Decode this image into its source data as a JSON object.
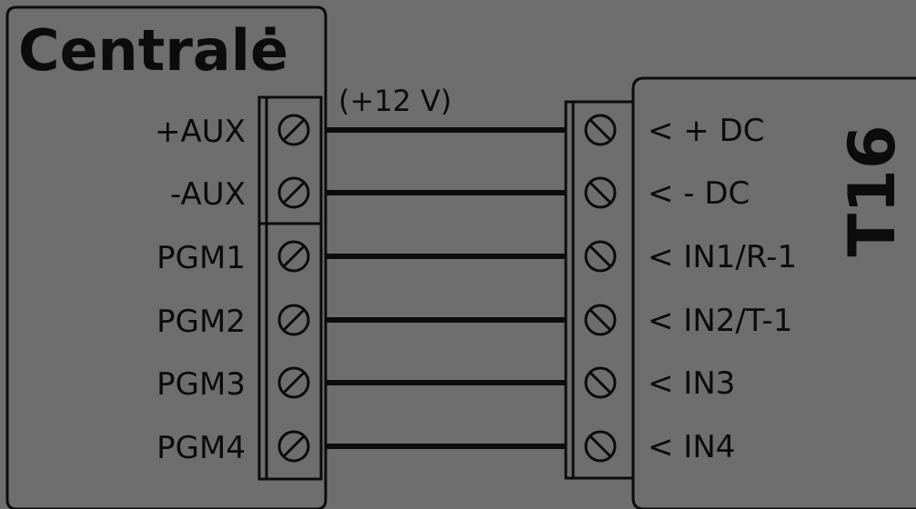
{
  "left_box": {
    "title": "Centralė",
    "terminals": [
      "+AUX",
      "-AUX",
      "PGM1",
      "PGM2",
      "PGM3",
      "PGM4"
    ]
  },
  "right_box": {
    "title": "T16",
    "terminals": [
      "< + DC",
      "< - DC",
      "< IN1/R-1",
      "< IN2/T-1",
      "< IN3",
      "< IN4"
    ]
  },
  "voltage_note": "(+12 V)",
  "colors": {
    "background": "#6e6e6e",
    "ink": "#0c0c0c"
  }
}
